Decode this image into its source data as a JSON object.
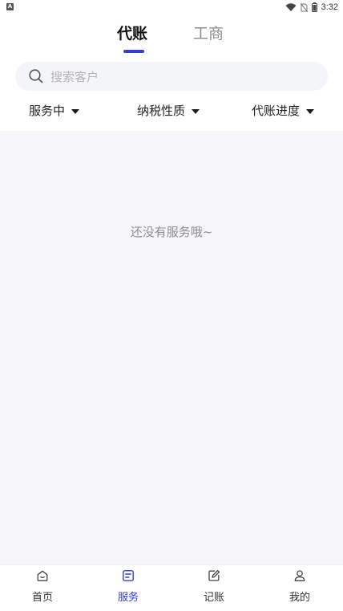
{
  "status_bar": {
    "time": "3:32",
    "left_icon_letter": "A",
    "icons": [
      "wifi-icon",
      "no-sim-icon",
      "battery-icon"
    ]
  },
  "top_tabs": {
    "active": "代账",
    "inactive": "工商",
    "accent_color": "#2f40c9"
  },
  "search": {
    "placeholder": "搜索客户"
  },
  "filters": {
    "status": "服务中",
    "tax_type": "纳税性质",
    "progress": "代账进度"
  },
  "content": {
    "empty_message": "还没有服务哦~"
  },
  "bottom_nav": {
    "items": [
      {
        "label": "首页",
        "icon": "home-icon"
      },
      {
        "label": "服务",
        "icon": "service-icon"
      },
      {
        "label": "记账",
        "icon": "edit-icon"
      },
      {
        "label": "我的",
        "icon": "user-icon"
      }
    ],
    "active_index": 1
  }
}
